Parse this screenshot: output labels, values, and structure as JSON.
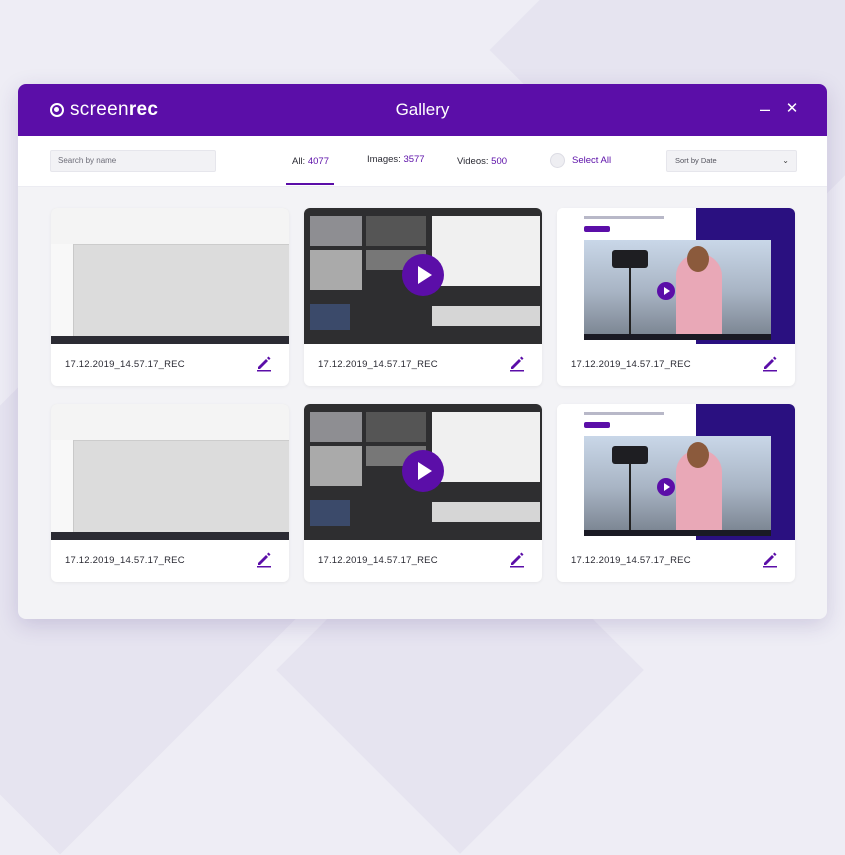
{
  "app": {
    "logo_light": "screen",
    "logo_bold": "rec",
    "title": "Gallery"
  },
  "window_controls": {
    "minimize": "–",
    "close": "✕"
  },
  "toolbar": {
    "search_placeholder": "Search by name",
    "tabs": [
      {
        "label": "All:",
        "count": "4077",
        "active": true
      },
      {
        "label": "Images:",
        "count": "3577",
        "active": false
      },
      {
        "label": "Videos:",
        "count": "500",
        "active": false
      }
    ],
    "select_all": "Select All",
    "sort": "Sort by Date",
    "sort_icon": "chevron-down-icon"
  },
  "colors": {
    "accent": "#5b0ea8",
    "background": "#eeedf5",
    "window_bg": "#f3f3f6"
  },
  "gallery": {
    "items": [
      {
        "name": "17.12.2019_14.57.17_REC",
        "thumb": "explorer"
      },
      {
        "name": "17.12.2019_14.57.17_REC",
        "thumb": "video"
      },
      {
        "name": "17.12.2019_14.57.17_REC",
        "thumb": "photo"
      },
      {
        "name": "17.12.2019_14.57.17_REC",
        "thumb": "explorer"
      },
      {
        "name": "17.12.2019_14.57.17_REC",
        "thumb": "video"
      },
      {
        "name": "17.12.2019_14.57.17_REC",
        "thumb": "photo"
      }
    ],
    "edit_icon": "pencil-icon"
  }
}
